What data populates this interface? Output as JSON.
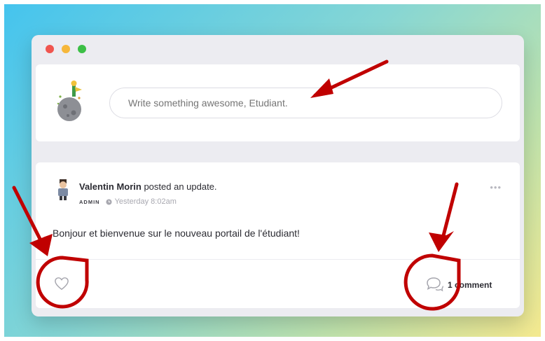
{
  "composer": {
    "placeholder": "Write something awesome, Etudiant.",
    "avatar_icon": "little-prince-planet-icon"
  },
  "post": {
    "author": "Valentin Morin",
    "action": " posted an update.",
    "role": "ADMIN",
    "timestamp": "Yesterday 8:02am",
    "body": "Bonjour et bienvenue sur le nouveau portail de l'étudiant!",
    "comment_count": "1 comment",
    "more_label": "•••"
  },
  "colors": {
    "annotation": "#c00000",
    "accent_gradient_start": "#45c4ee",
    "accent_gradient_end": "#f4e98f"
  }
}
